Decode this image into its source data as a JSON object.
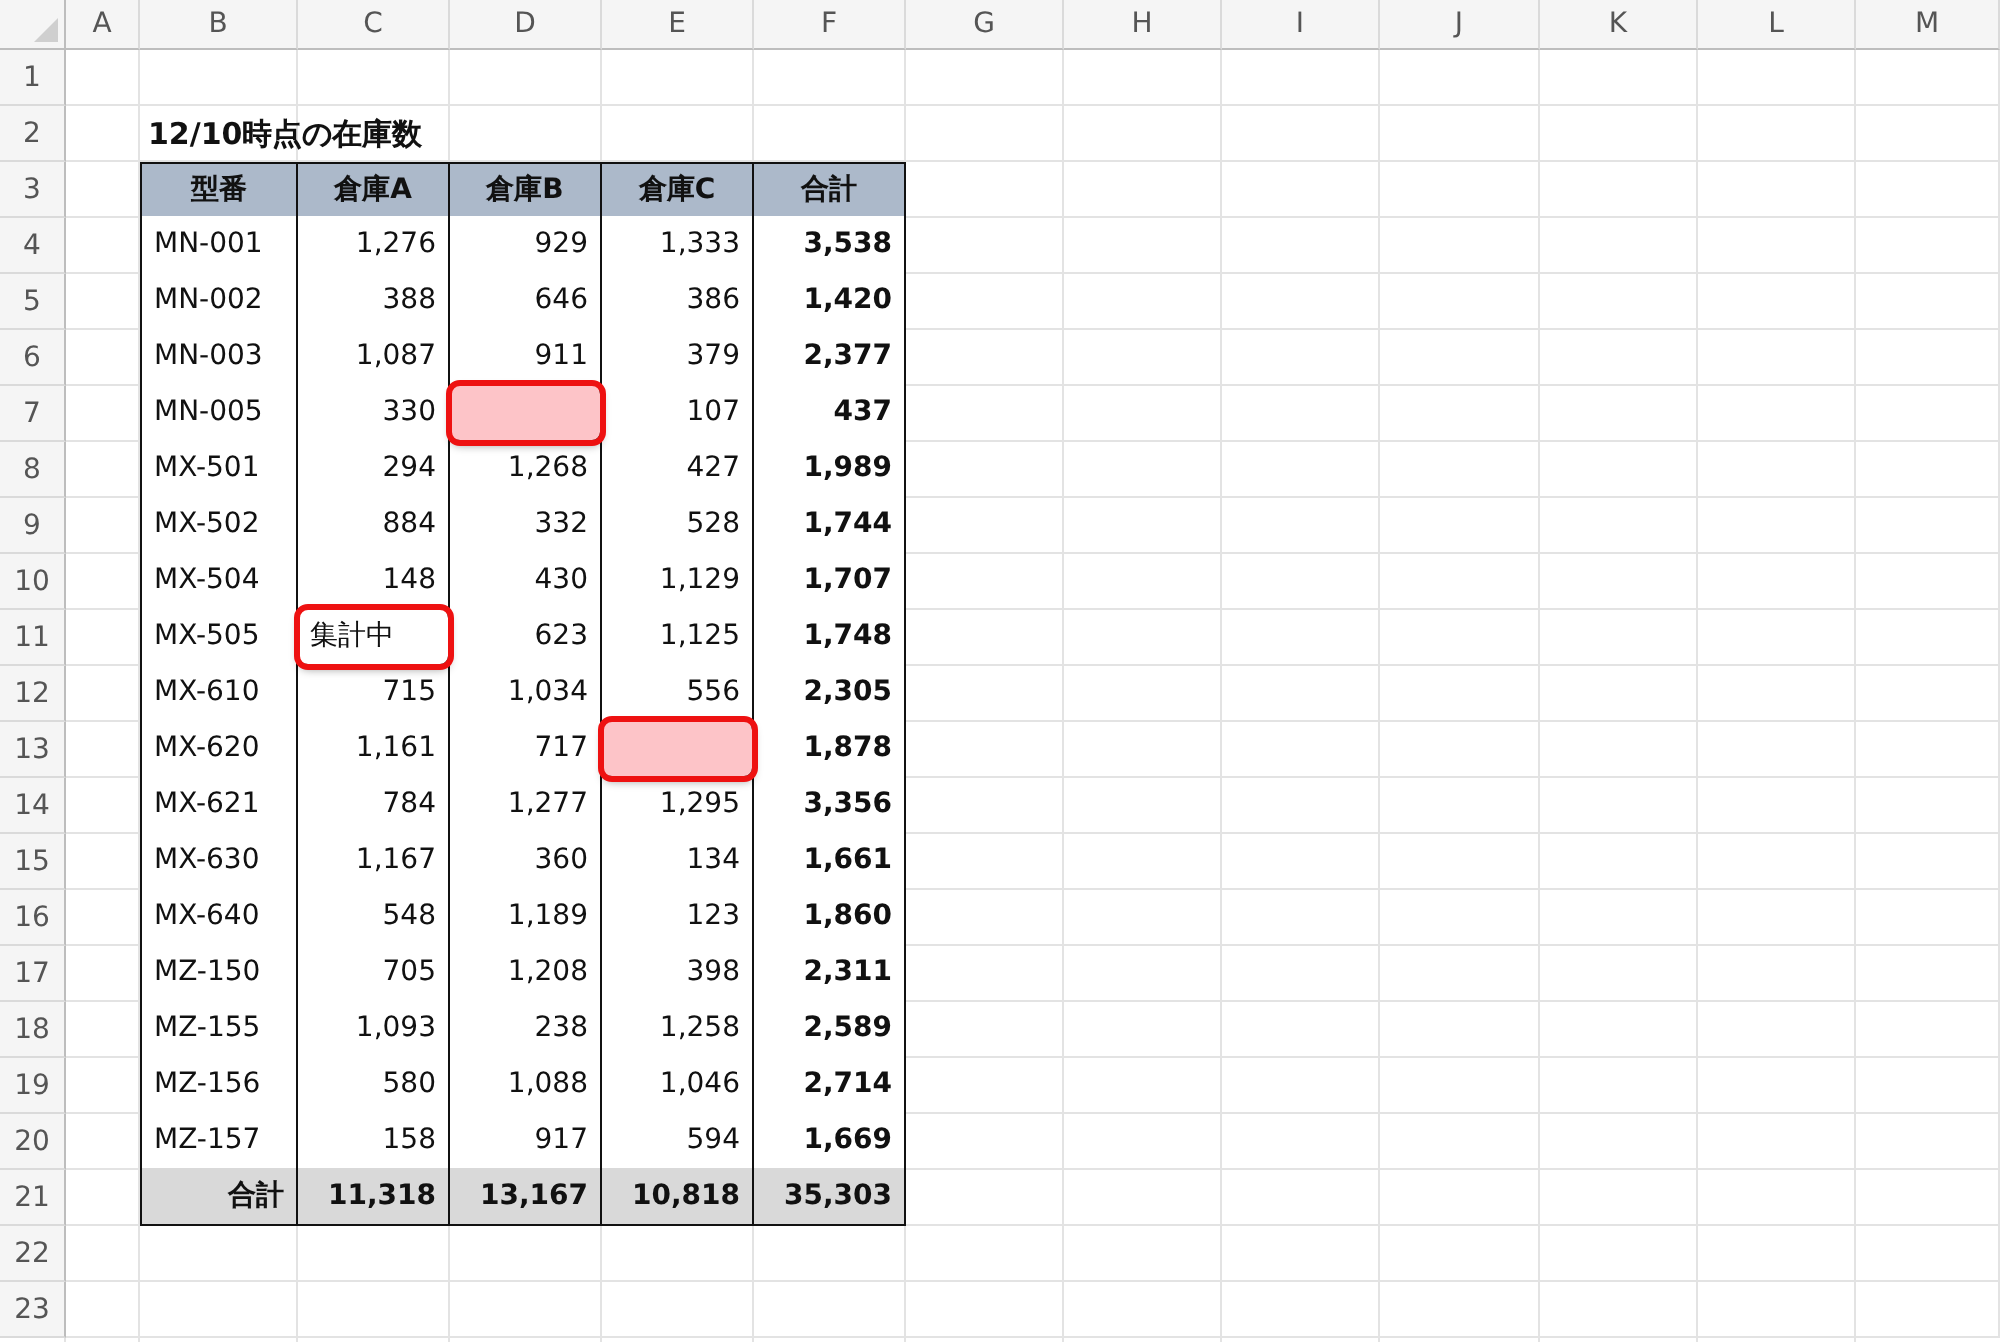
{
  "sheet": {
    "column_letters": [
      "A",
      "B",
      "C",
      "D",
      "E",
      "F",
      "G",
      "H",
      "I",
      "J",
      "K",
      "L",
      "M"
    ],
    "row_numbers": [
      "1",
      "2",
      "3",
      "4",
      "5",
      "6",
      "7",
      "8",
      "9",
      "10",
      "11",
      "12",
      "13",
      "14",
      "15",
      "16",
      "17",
      "18",
      "19",
      "20",
      "21",
      "22",
      "23"
    ]
  },
  "title": "12/10時点の在庫数",
  "table": {
    "columns": [
      "型番",
      "倉庫A",
      "倉庫B",
      "倉庫C",
      "合計"
    ],
    "rows": [
      {
        "cells": [
          {
            "text": "MN-001",
            "flagged": false
          },
          {
            "text": "1,276",
            "flagged": false
          },
          {
            "text": "929",
            "flagged": false
          },
          {
            "text": "1,333",
            "flagged": false
          },
          {
            "text": "3,538",
            "flagged": false
          }
        ]
      },
      {
        "cells": [
          {
            "text": "MN-002",
            "flagged": false
          },
          {
            "text": "388",
            "flagged": false
          },
          {
            "text": "646",
            "flagged": false
          },
          {
            "text": "386",
            "flagged": false
          },
          {
            "text": "1,420",
            "flagged": false
          }
        ]
      },
      {
        "cells": [
          {
            "text": "MN-003",
            "flagged": false
          },
          {
            "text": "1,087",
            "flagged": false
          },
          {
            "text": "911",
            "flagged": false
          },
          {
            "text": "379",
            "flagged": false
          },
          {
            "text": "2,377",
            "flagged": false
          }
        ]
      },
      {
        "cells": [
          {
            "text": "MN-005",
            "flagged": false
          },
          {
            "text": "330",
            "flagged": false
          },
          {
            "flagged": true
          },
          {
            "text": "107",
            "flagged": false
          },
          {
            "text": "437",
            "flagged": false
          }
        ]
      },
      {
        "cells": [
          {
            "text": "MX-501",
            "flagged": false
          },
          {
            "text": "294",
            "flagged": false
          },
          {
            "text": "1,268",
            "flagged": false
          },
          {
            "text": "427",
            "flagged": false
          },
          {
            "text": "1,989",
            "flagged": false
          }
        ]
      },
      {
        "cells": [
          {
            "text": "MX-502",
            "flagged": false
          },
          {
            "text": "884",
            "flagged": false
          },
          {
            "text": "332",
            "flagged": false
          },
          {
            "text": "528",
            "flagged": false
          },
          {
            "text": "1,744",
            "flagged": false
          }
        ]
      },
      {
        "cells": [
          {
            "text": "MX-504",
            "flagged": false
          },
          {
            "text": "148",
            "flagged": false
          },
          {
            "text": "430",
            "flagged": false
          },
          {
            "text": "1,129",
            "flagged": false
          },
          {
            "text": "1,707",
            "flagged": false
          }
        ]
      },
      {
        "cells": [
          {
            "text": "MX-505",
            "flagged": false
          },
          {
            "text": "集計中",
            "flagged": true
          },
          {
            "text": "623",
            "flagged": false
          },
          {
            "text": "1,125",
            "flagged": false
          },
          {
            "text": "1,748",
            "flagged": false
          }
        ]
      },
      {
        "cells": [
          {
            "text": "MX-610",
            "flagged": false
          },
          {
            "text": "715",
            "flagged": false
          },
          {
            "text": "1,034",
            "flagged": false
          },
          {
            "text": "556",
            "flagged": false
          },
          {
            "text": "2,305",
            "flagged": false
          }
        ]
      },
      {
        "cells": [
          {
            "text": "MX-620",
            "flagged": false
          },
          {
            "text": "1,161",
            "flagged": false
          },
          {
            "text": "717",
            "flagged": false
          },
          {
            "flagged": true
          },
          {
            "text": "1,878",
            "flagged": false
          }
        ]
      },
      {
        "cells": [
          {
            "text": "MX-621",
            "flagged": false
          },
          {
            "text": "784",
            "flagged": false
          },
          {
            "text": "1,277",
            "flagged": false
          },
          {
            "text": "1,295",
            "flagged": false
          },
          {
            "text": "3,356",
            "flagged": false
          }
        ]
      },
      {
        "cells": [
          {
            "text": "MX-630",
            "flagged": false
          },
          {
            "text": "1,167",
            "flagged": false
          },
          {
            "text": "360",
            "flagged": false
          },
          {
            "text": "134",
            "flagged": false
          },
          {
            "text": "1,661",
            "flagged": false
          }
        ]
      },
      {
        "cells": [
          {
            "text": "MX-640",
            "flagged": false
          },
          {
            "text": "548",
            "flagged": false
          },
          {
            "text": "1,189",
            "flagged": false
          },
          {
            "text": "123",
            "flagged": false
          },
          {
            "text": "1,860",
            "flagged": false
          }
        ]
      },
      {
        "cells": [
          {
            "text": "MZ-150",
            "flagged": false
          },
          {
            "text": "705",
            "flagged": false
          },
          {
            "text": "1,208",
            "flagged": false
          },
          {
            "text": "398",
            "flagged": false
          },
          {
            "text": "2,311",
            "flagged": false
          }
        ]
      },
      {
        "cells": [
          {
            "text": "MZ-155",
            "flagged": false
          },
          {
            "text": "1,093",
            "flagged": false
          },
          {
            "text": "238",
            "flagged": false
          },
          {
            "text": "1,258",
            "flagged": false
          },
          {
            "text": "2,589",
            "flagged": false
          }
        ]
      },
      {
        "cells": [
          {
            "text": "MZ-156",
            "flagged": false
          },
          {
            "text": "580",
            "flagged": false
          },
          {
            "text": "1,088",
            "flagged": false
          },
          {
            "text": "1,046",
            "flagged": false
          },
          {
            "text": "2,714",
            "flagged": false
          }
        ]
      },
      {
        "cells": [
          {
            "text": "MZ-157",
            "flagged": false
          },
          {
            "text": "158",
            "flagged": false
          },
          {
            "text": "917",
            "flagged": false
          },
          {
            "text": "594",
            "flagged": false
          },
          {
            "text": "1,669",
            "flagged": false
          }
        ]
      }
    ],
    "footer": [
      "合計",
      "11,318",
      "13,167",
      "10,818",
      "35,303"
    ]
  }
}
